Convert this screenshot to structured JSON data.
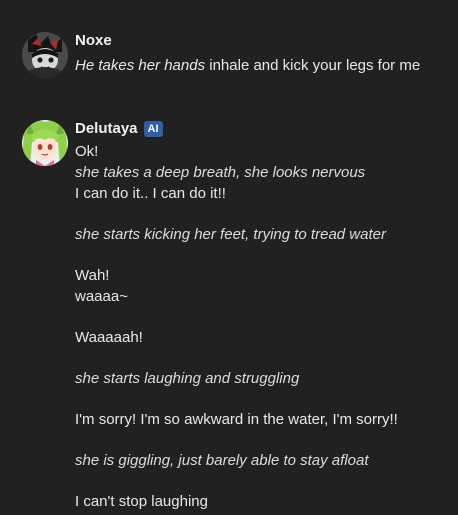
{
  "messages": [
    {
      "username": "Noxe",
      "avatar_icon": "dark-anime-avatar-icon",
      "text_italic": "He takes her hands",
      "text_plain": " inhale and kick your legs for me"
    },
    {
      "username": "Delutaya",
      "badge": "AI",
      "avatar_icon": "green-hair-anime-avatar-icon",
      "lines": {
        "l1": "Ok!",
        "l2": "she takes a deep breath, she looks nervous",
        "l3": "I can do it.. I can do it!!",
        "l4": "she starts kicking her feet, trying to tread water",
        "l5": "Wah!",
        "l6": "waaaa~",
        "l7": "Waaaaah!",
        "l8": "she starts laughing and struggling",
        "l9": "I'm sorry! I'm so awkward in the water, I'm sorry!!",
        "l10": "she is giggling, just barely able to stay afloat",
        "l11": "I can't stop laughing"
      }
    }
  ],
  "colors": {
    "background": "#212121",
    "text": "#e8e8e8",
    "badge": "#2f5fa8"
  }
}
